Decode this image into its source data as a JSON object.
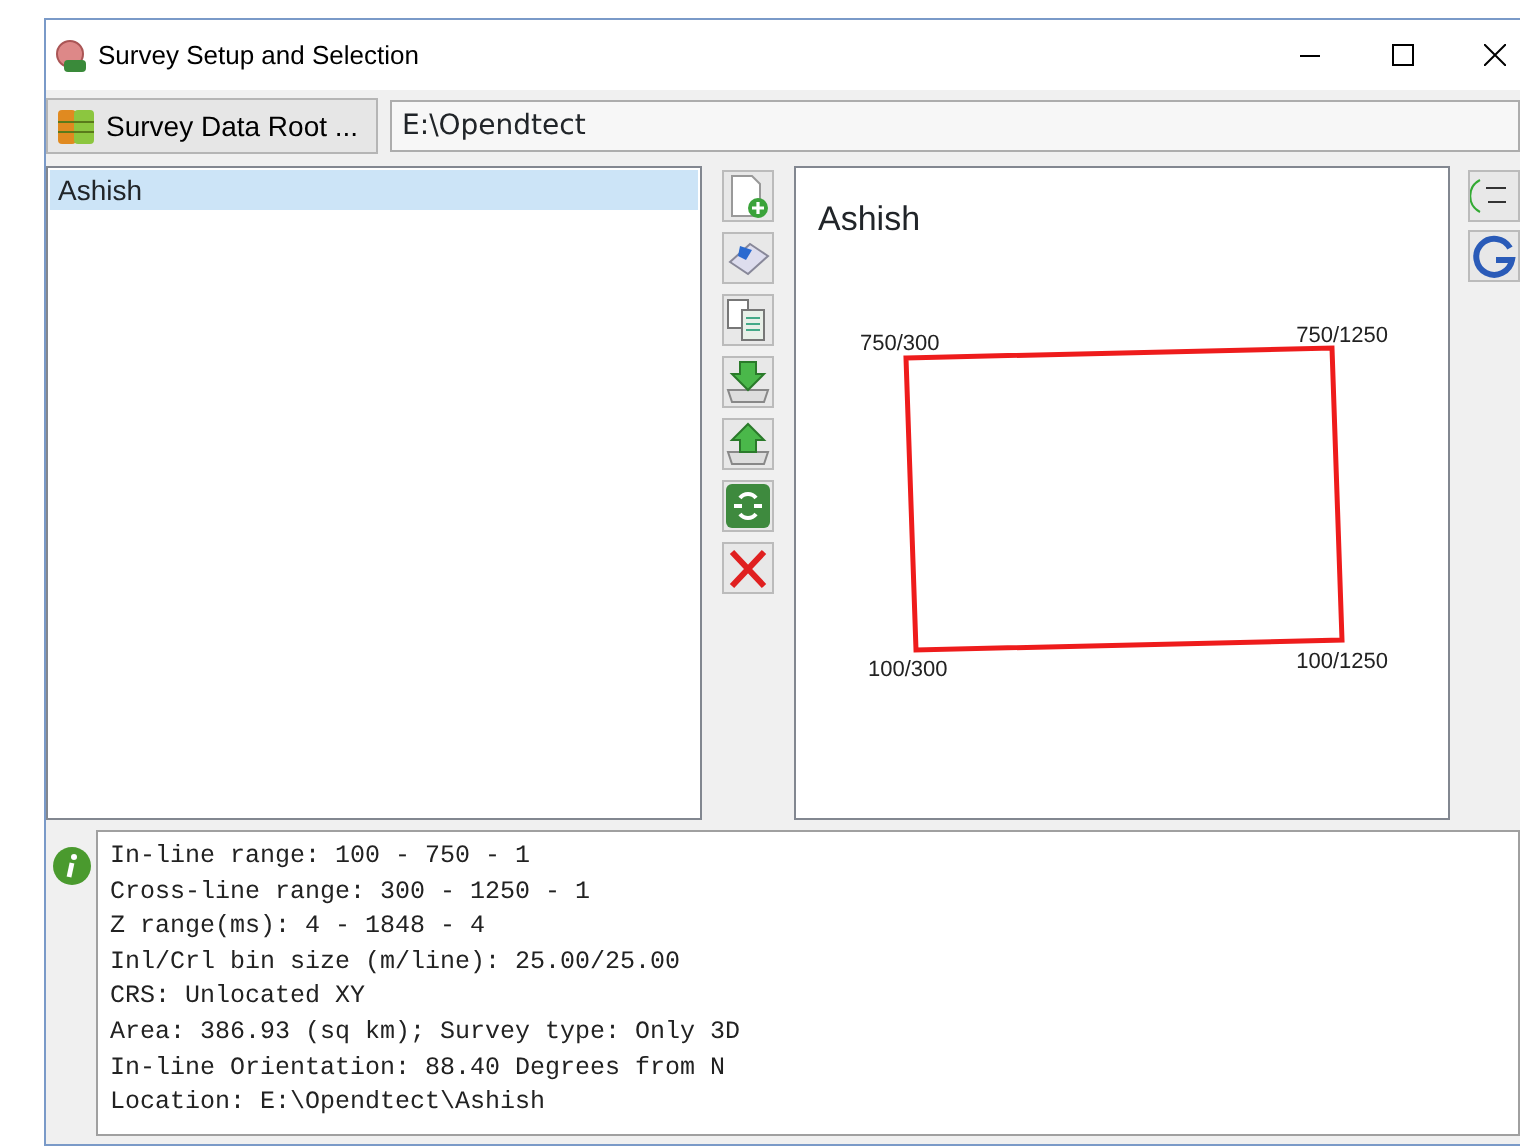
{
  "window": {
    "title": "Survey Setup and Selection"
  },
  "root": {
    "button": "Survey Data Root ...",
    "path": "E:\\Opendtect"
  },
  "surveys": [
    {
      "name": "Ashish",
      "selected": true
    }
  ],
  "tools": [
    {
      "kind": "new"
    },
    {
      "kind": "edit"
    },
    {
      "kind": "copy"
    },
    {
      "kind": "import"
    },
    {
      "kind": "export"
    },
    {
      "kind": "merge"
    },
    {
      "kind": "remove"
    }
  ],
  "side_tools": [
    {
      "kind": "xy"
    },
    {
      "kind": "google"
    }
  ],
  "map": {
    "title": "Ashish",
    "corners": [
      {
        "label": "750/300"
      },
      {
        "label": "750/1250"
      },
      {
        "label": "100/300"
      },
      {
        "label": "100/1250"
      }
    ]
  },
  "info": [
    "In-line range: 100 - 750 - 1",
    "Cross-line range: 300 - 1250 - 1",
    "Z range(ms): 4 - 1848 - 4",
    "Inl/Crl bin size (m/line): 25.00/25.00",
    "CRS: Unlocated XY",
    "Area: 386.93 (sq km); Survey type: Only 3D",
    "In-line Orientation: 88.40 Degrees from N",
    "Location: E:\\Opendtect\\Ashish"
  ]
}
